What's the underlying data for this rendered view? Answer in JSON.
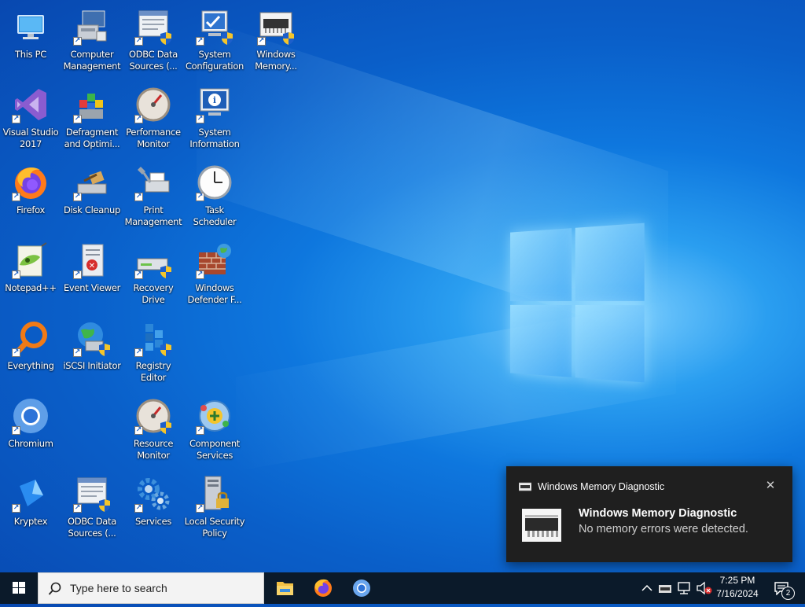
{
  "desktop": {
    "icons": [
      {
        "label": "This PC",
        "icon": "this-pc-icon"
      },
      {
        "label": "Computer Management",
        "icon": "computer-management-icon"
      },
      {
        "label": "ODBC Data Sources (...",
        "icon": "odbc-icon"
      },
      {
        "label": "System Configuration",
        "icon": "system-configuration-icon"
      },
      {
        "label": "Windows Memory...",
        "icon": "memory-chip-icon"
      },
      {
        "label": "Visual Studio 2017",
        "icon": "visual-studio-icon"
      },
      {
        "label": "Defragment and Optimi...",
        "icon": "defragment-icon"
      },
      {
        "label": "Performance Monitor",
        "icon": "performance-monitor-icon"
      },
      {
        "label": "System Information",
        "icon": "system-information-icon"
      },
      {
        "label": "Firefox",
        "icon": "firefox-icon"
      },
      {
        "label": "Disk Cleanup",
        "icon": "disk-cleanup-icon"
      },
      {
        "label": "Print Management",
        "icon": "print-management-icon"
      },
      {
        "label": "Task Scheduler",
        "icon": "task-scheduler-icon"
      },
      {
        "label": "Notepad++",
        "icon": "notepad-plus-plus-icon"
      },
      {
        "label": "Event Viewer",
        "icon": "event-viewer-icon"
      },
      {
        "label": "Recovery Drive",
        "icon": "recovery-drive-icon"
      },
      {
        "label": "Windows Defender F...",
        "icon": "firewall-icon"
      },
      {
        "label": "Everything",
        "icon": "everything-search-icon"
      },
      {
        "label": "iSCSI Initiator",
        "icon": "iscsi-initiator-icon"
      },
      {
        "label": "Registry Editor",
        "icon": "registry-editor-icon"
      },
      {
        "label": "Chromium",
        "icon": "chromium-icon"
      },
      {
        "label": "Resource Monitor",
        "icon": "resource-monitor-icon"
      },
      {
        "label": "Component Services",
        "icon": "component-services-icon"
      },
      {
        "label": "Kryptex",
        "icon": "kryptex-icon"
      },
      {
        "label": "ODBC Data Sources (...",
        "icon": "odbc-icon"
      },
      {
        "label": "Services",
        "icon": "services-gear-icon"
      },
      {
        "label": "Local Security Policy",
        "icon": "local-security-policy-icon"
      }
    ]
  },
  "notification": {
    "app_name": "Windows Memory Diagnostic",
    "title": "Windows Memory Diagnostic",
    "body": "No memory errors were detected.",
    "close_glyph": "✕"
  },
  "taskbar": {
    "search_placeholder": "Type here to search",
    "pinned": [
      "file-explorer-icon",
      "firefox-icon",
      "chromium-icon"
    ],
    "tray": {
      "time": "7:25 PM",
      "date": "7/16/2024",
      "notification_count": "2"
    }
  },
  "colors": {
    "taskbar_bg": "#0b1a2a",
    "toast_bg": "#1f1f1f",
    "desktop_accent": "#0a5fc9"
  }
}
